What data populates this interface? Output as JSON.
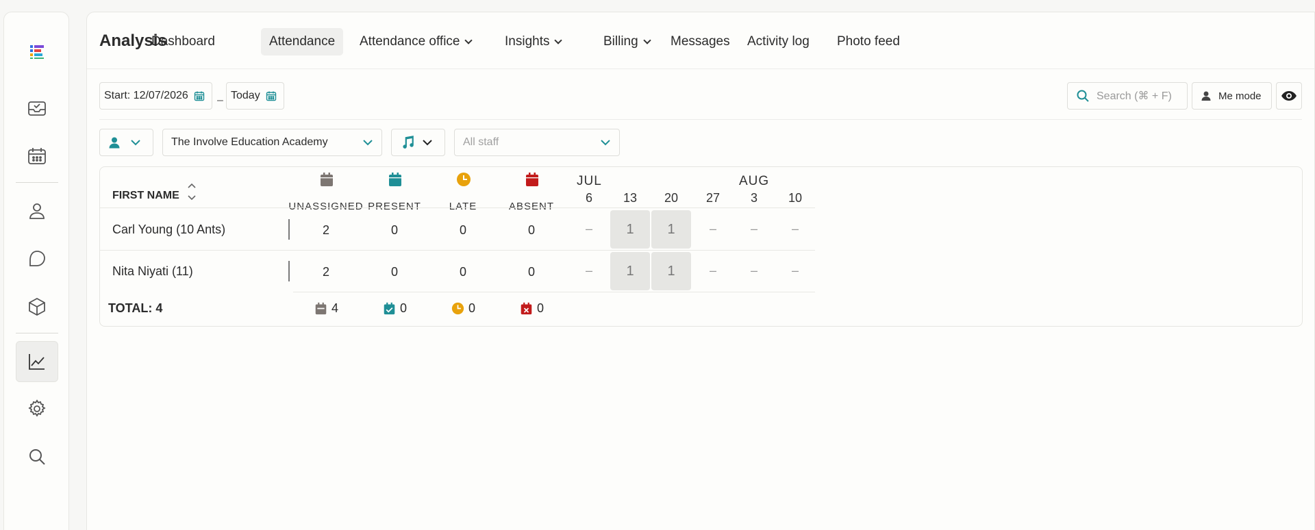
{
  "nav": {
    "title": "Analysis",
    "items": [
      {
        "label": "Dashboard"
      },
      {
        "label": "Attendance"
      },
      {
        "label": "Attendance office"
      },
      {
        "label": "Insights"
      },
      {
        "label": "Billing"
      },
      {
        "label": "Messages"
      },
      {
        "label": "Activity log"
      },
      {
        "label": "Photo feed"
      }
    ]
  },
  "filters": {
    "start_label": "Start: 12/07/2026",
    "separator": "–",
    "end_label": "Today",
    "search_placeholder": "Search (⌘ + F)",
    "me_mode": "Me mode",
    "school": "The Involve Education Academy",
    "staff_placeholder": "All staff"
  },
  "colors": {
    "accent": "#1f8f96",
    "unassigned": "#7d7672",
    "present": "#1f8f96",
    "late": "#e8a20c",
    "absent": "#c21b1b"
  },
  "table": {
    "first_name_header": "FIRST NAME",
    "stat_headers": [
      "UNASSIGNED",
      "PRESENT",
      "LATE",
      "ABSENT"
    ],
    "months": [
      {
        "label": "JUL"
      },
      {
        "label": "AUG"
      }
    ],
    "weeks": [
      "6",
      "13",
      "20",
      "27",
      "3",
      "10"
    ],
    "rows": [
      {
        "name": "Carl Young (10 Ants)",
        "stats": [
          "2",
          "0",
          "0",
          "0"
        ],
        "weeks": [
          "–",
          "1",
          "1",
          "–",
          "–",
          "–"
        ]
      },
      {
        "name": "Nita Niyati (11)",
        "stats": [
          "2",
          "0",
          "0",
          "0"
        ],
        "weeks": [
          "–",
          "1",
          "1",
          "–",
          "–",
          "–"
        ]
      }
    ],
    "total_label": "TOTAL: 4",
    "totals": [
      "4",
      "0",
      "0",
      "0"
    ]
  }
}
